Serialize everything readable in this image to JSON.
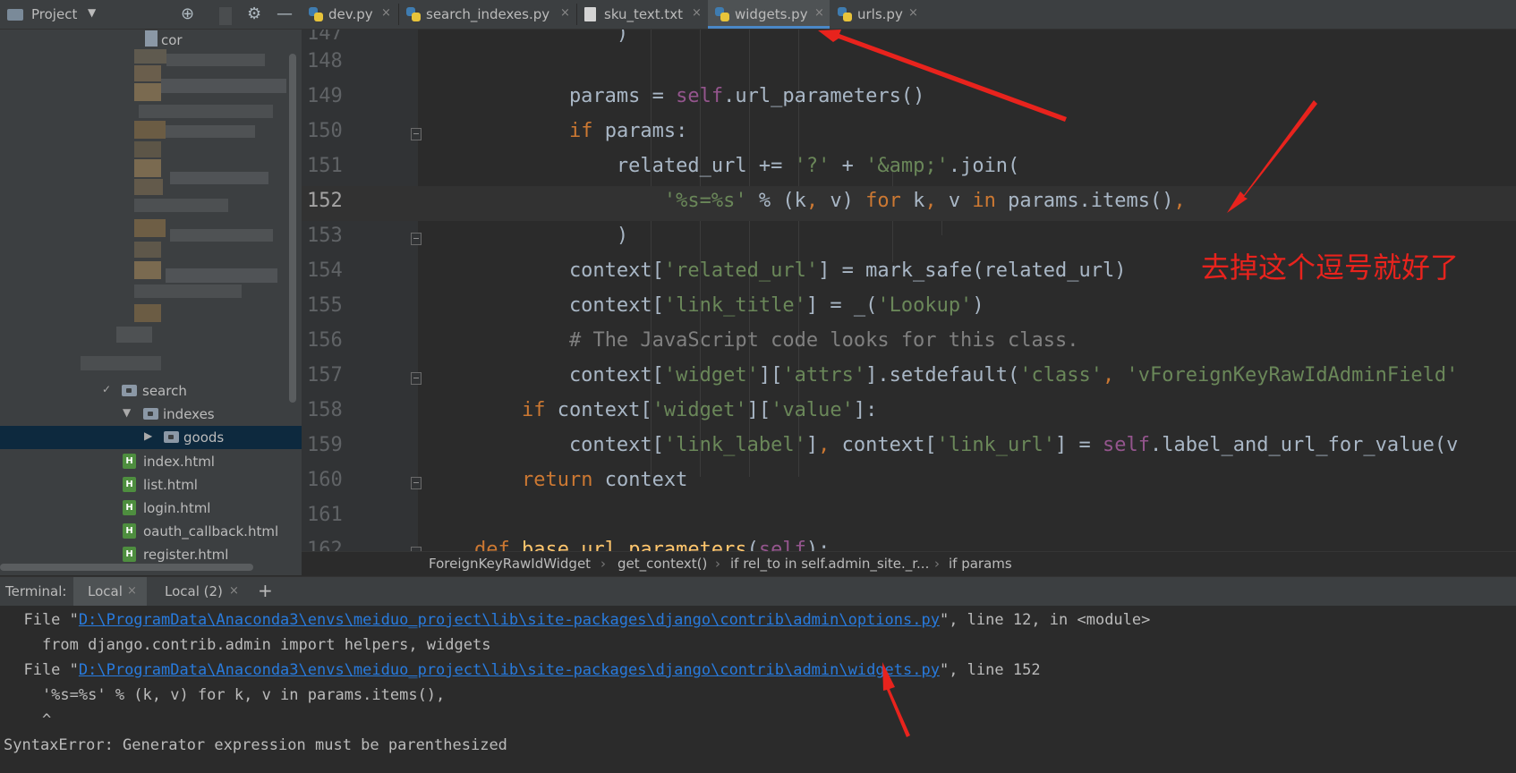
{
  "project_panel": {
    "title": "Project",
    "tree": [
      {
        "label": "search"
      },
      {
        "label": "indexes"
      },
      {
        "label": "goods"
      },
      {
        "label": "index.html"
      },
      {
        "label": "list.html"
      },
      {
        "label": "login.html"
      },
      {
        "label": "oauth_callback.html"
      },
      {
        "label": "register.html"
      }
    ],
    "partial_label": "cor"
  },
  "tabs": [
    {
      "label": "dev.py"
    },
    {
      "label": "search_indexes.py"
    },
    {
      "label": "sku_text.txt"
    },
    {
      "label": "widgets.py",
      "active": true
    },
    {
      "label": "urls.py"
    }
  ],
  "editor": {
    "current_line": "152",
    "lines": [
      {
        "no": "147"
      },
      {
        "no": "148"
      },
      {
        "no": "149"
      },
      {
        "no": "150"
      },
      {
        "no": "151"
      },
      {
        "no": "152"
      },
      {
        "no": "153"
      },
      {
        "no": "154"
      },
      {
        "no": "155"
      },
      {
        "no": "156"
      },
      {
        "no": "157"
      },
      {
        "no": "158"
      },
      {
        "no": "159"
      },
      {
        "no": "160"
      },
      {
        "no": "161"
      },
      {
        "no": "162"
      }
    ]
  },
  "breadcrumb": [
    "ForeignKeyRawIdWidget",
    "get_context()",
    "if rel_to in self.admin_site._r...",
    "if params"
  ],
  "terminal": {
    "label": "Terminal:",
    "tabs": [
      {
        "label": "Local"
      },
      {
        "label": "Local (2)"
      }
    ],
    "add": "+",
    "lines": {
      "l1_prefix": "  File \"",
      "l1_path": "D:\\ProgramData\\Anaconda3\\envs\\meiduo_project\\lib\\site-packages\\django\\contrib\\admin\\options.py",
      "l1_suffix": "\", line 12, in <module>",
      "l2": "    from django.contrib.admin import helpers, widgets",
      "l3_prefix": "  File \"",
      "l3_path": "D:\\ProgramData\\Anaconda3\\envs\\meiduo_project\\lib\\site-packages\\django\\contrib\\admin\\widgets.py",
      "l3_suffix": "\", line 152",
      "l4": "    '%s=%s' % (k, v) for k, v in params.items(),",
      "l5": "    ^",
      "l6": "SyntaxError: Generator expression must be parenthesized"
    }
  },
  "annotation": {
    "note": "去掉这个逗号就好了",
    "color": "#e8231d"
  },
  "colors": {
    "keyword": "#cc7832",
    "string": "#6a8759",
    "self": "#94558d",
    "comment": "#808080",
    "identifier": "#a9b7c6",
    "link": "#287bde",
    "active_tab_underline": "#4a88c7"
  }
}
